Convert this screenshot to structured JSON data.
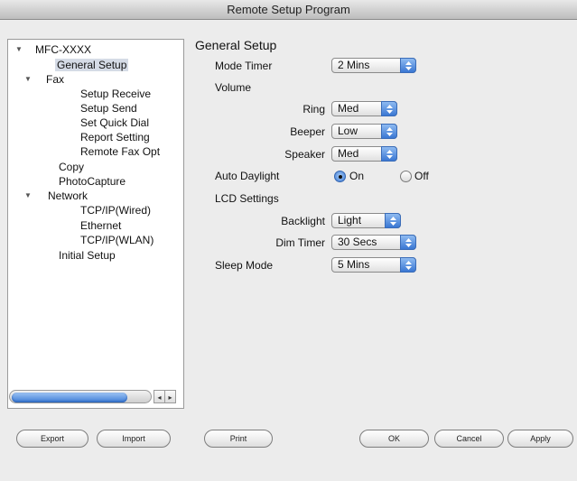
{
  "window": {
    "title": "Remote Setup Program"
  },
  "tree": {
    "items": [
      {
        "label": "MFC-XXXX",
        "expanded": true
      },
      {
        "label": "General Setup",
        "selected": true
      },
      {
        "label": "Fax",
        "expanded": true
      },
      {
        "label": "Setup Receive"
      },
      {
        "label": "Setup Send"
      },
      {
        "label": "Set Quick Dial"
      },
      {
        "label": "Report Setting"
      },
      {
        "label": "Remote Fax Opt"
      },
      {
        "label": "Copy"
      },
      {
        "label": "PhotoCapture"
      },
      {
        "label": "Network",
        "expanded": true
      },
      {
        "label": "TCP/IP(Wired)"
      },
      {
        "label": "Ethernet"
      },
      {
        "label": "TCP/IP(WLAN)"
      },
      {
        "label": "Initial Setup"
      }
    ],
    "scroll_left": "◂",
    "scroll_right": "▸"
  },
  "panel": {
    "title": "General Setup",
    "mode_timer": {
      "label": "Mode Timer",
      "value": "2 Mins"
    },
    "volume": {
      "label": "Volume",
      "ring": {
        "label": "Ring",
        "value": "Med"
      },
      "beeper": {
        "label": "Beeper",
        "value": "Low"
      },
      "speaker": {
        "label": "Speaker",
        "value": "Med"
      }
    },
    "auto_daylight": {
      "label": "Auto Daylight",
      "on_label": "On",
      "off_label": "Off",
      "selected": "On"
    },
    "lcd": {
      "label": "LCD Settings",
      "backlight": {
        "label": "Backlight",
        "value": "Light"
      },
      "dim_timer": {
        "label": "Dim Timer",
        "value": "30 Secs"
      }
    },
    "sleep_mode": {
      "label": "Sleep Mode",
      "value": "5 Mins"
    }
  },
  "buttons": {
    "export": "Export",
    "import": "Import",
    "print": "Print",
    "ok": "OK",
    "cancel": "Cancel",
    "apply": "Apply"
  },
  "colors": {
    "accent": "#3a77d3",
    "selection": "#d5dbe6"
  }
}
